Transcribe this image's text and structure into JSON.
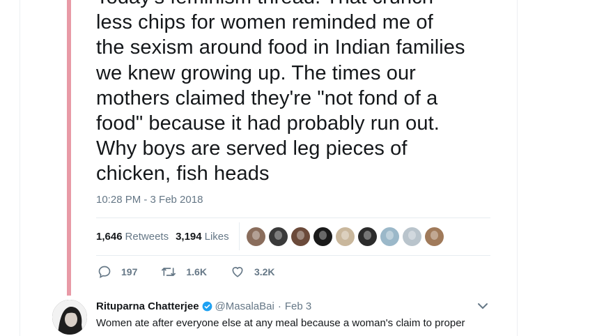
{
  "tweet": {
    "text": "Today's feminism thread. That crunch\nless chips for women reminded me of\nthe sexism around food in Indian families\nwe knew growing up. The times our\nmothers claimed they're \"not fond of a\nfood\" because it had probably run out.\nWhy boys are served leg pieces of\nchicken, fish heads",
    "timestamp": "10:28 PM - 3 Feb 2018",
    "retweets_count": "1,646",
    "retweets_label": "Retweets",
    "likes_count": "3,194",
    "likes_label": "Likes",
    "liker_avatars": [
      {
        "color": "#8a6d5c"
      },
      {
        "color": "#3a3a3a"
      },
      {
        "color": "#6b4a3a"
      },
      {
        "color": "#1a1a1a"
      },
      {
        "color": "#c9b79c"
      },
      {
        "color": "#2b2b2b"
      },
      {
        "color": "#9bb8c9"
      },
      {
        "color": "#b9c4cc"
      },
      {
        "color": "#a07a5a"
      }
    ],
    "actions": {
      "reply_count": "197",
      "retweet_count": "1.6K",
      "like_count": "3.2K"
    }
  },
  "reply": {
    "name": "Rituparna Chatterjee",
    "handle": "@MasalaBai",
    "separator": "·",
    "date": "Feb 3",
    "text": "Women ate after everyone else at any meal because a woman's claim to proper"
  },
  "colors": {
    "thread_line": "#e89aa6",
    "text": "#14171a",
    "muted": "#657786",
    "verified": "#1da1f2"
  }
}
